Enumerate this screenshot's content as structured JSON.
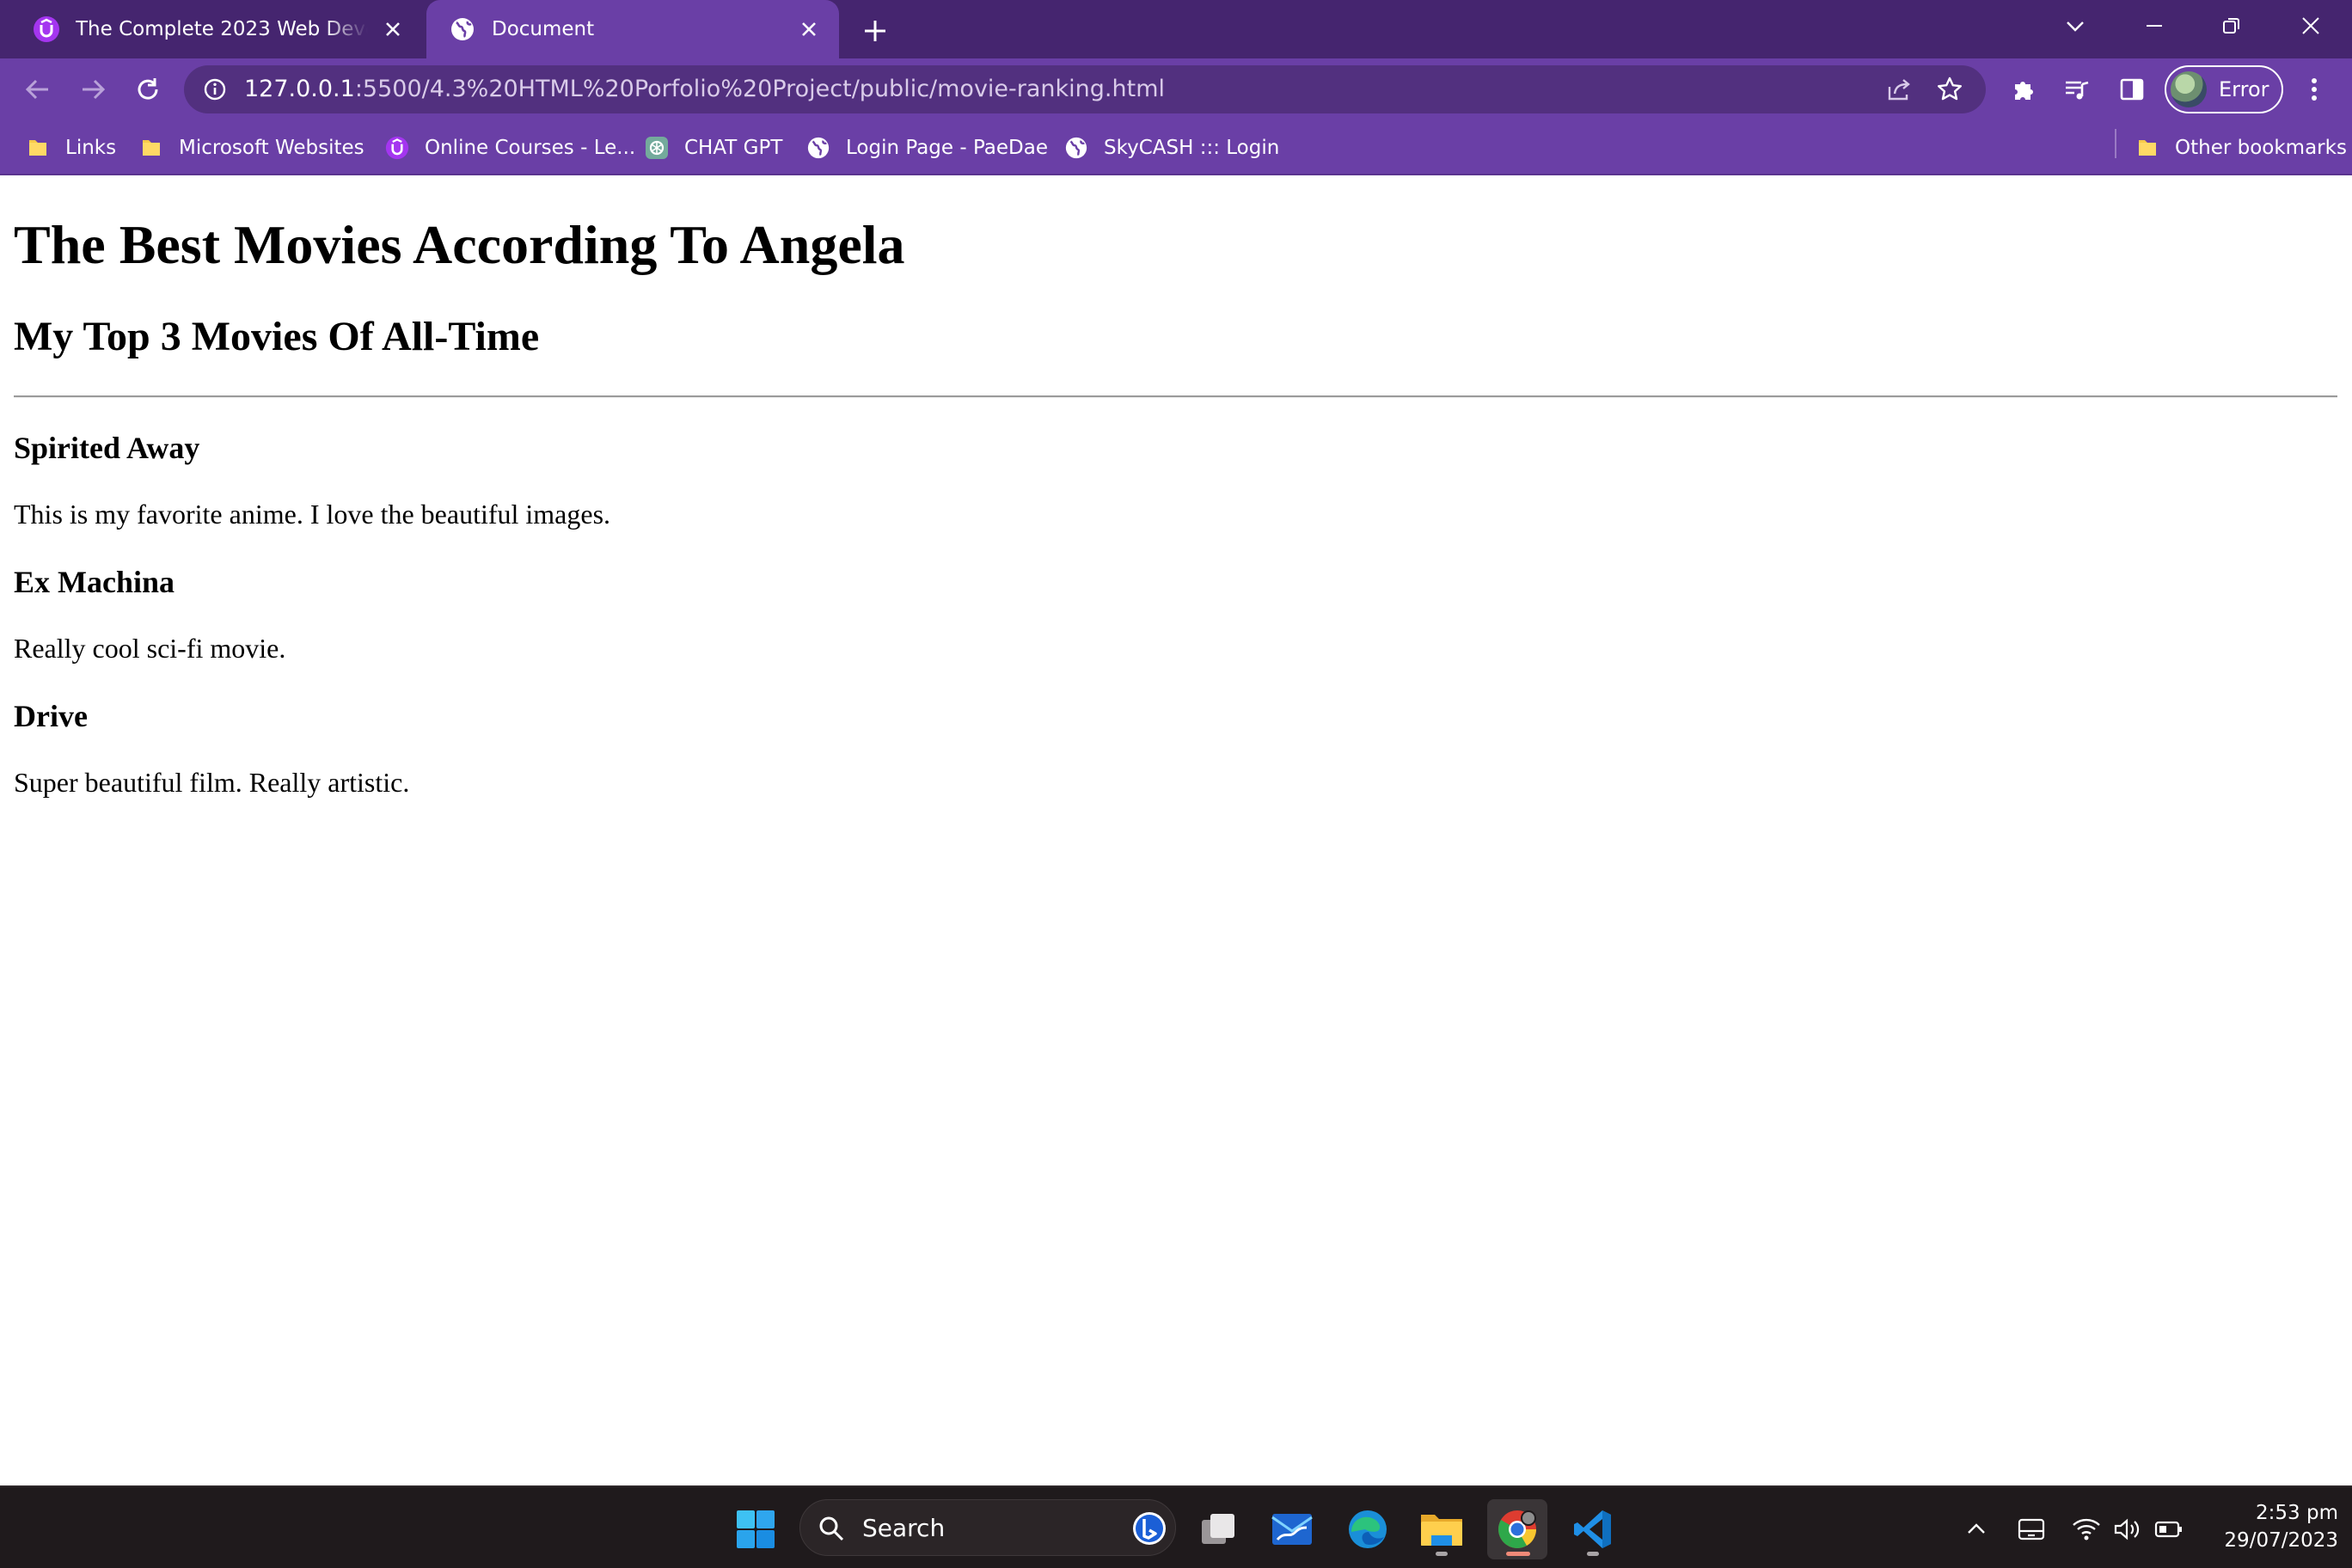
{
  "browser": {
    "tabs": [
      {
        "title": "The Complete 2023 Web Development Bootcamp",
        "icon": "udemy-icon",
        "active": false
      },
      {
        "title": "Document",
        "icon": "globe-icon",
        "active": true
      }
    ],
    "address": {
      "host": "127.0.0.1",
      "rest": ":5500/4.3%20HTML%20Porfolio%20Project/public/movie-ranking.html"
    },
    "profile_label": "Error",
    "bookmarks": [
      {
        "label": "Links",
        "icon": "folder-icon"
      },
      {
        "label": "Microsoft Websites",
        "icon": "folder-icon"
      },
      {
        "label": "Online Courses - Le...",
        "icon": "udemy-icon"
      },
      {
        "label": "CHAT GPT",
        "icon": "chatgpt-icon"
      },
      {
        "label": "Login Page - PaeDae",
        "icon": "globe-icon"
      },
      {
        "label": "SkyCASH ::: Login",
        "icon": "globe-icon"
      }
    ],
    "other_bookmarks": "Other bookmarks",
    "theme_colors": {
      "tabstrip": "#45256f",
      "toolbar": "#6a3fa6"
    }
  },
  "page": {
    "h1": "The Best Movies According To Angela",
    "h2": "My Top 3 Movies Of All-Time",
    "movies": [
      {
        "title": "Spirited Away",
        "description": "This is my favorite anime. I love the beautiful images."
      },
      {
        "title": "Ex Machina",
        "description": "Really cool sci-fi movie."
      },
      {
        "title": "Drive",
        "description": "Super beautiful film. Really artistic."
      }
    ]
  },
  "taskbar": {
    "search_label": "Search",
    "apps": [
      "windows-start-icon",
      "bing-icon",
      "task-view-icon",
      "mail-icon",
      "edge-icon",
      "file-explorer-icon",
      "chrome-icon",
      "vscode-icon"
    ],
    "time": "2:53 pm",
    "date": "29/07/2023"
  }
}
